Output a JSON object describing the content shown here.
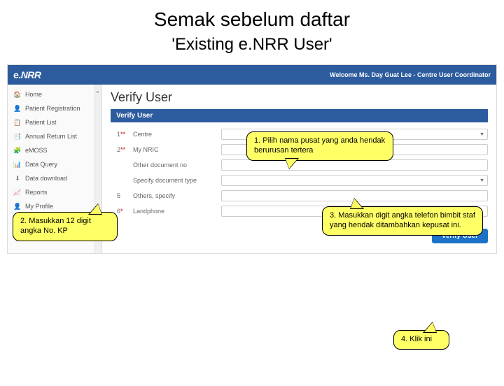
{
  "slide": {
    "title": "Semak sebelum daftar",
    "subtitle": "'Existing e.NRR User'"
  },
  "topbar": {
    "logo_prefix": "e.",
    "logo_main": "NRR",
    "welcome": "Welcome Ms. Day Guat Lee - Centre User Coordinator"
  },
  "sidebar": {
    "items": [
      {
        "icon": "🏠",
        "label": "Home"
      },
      {
        "icon": "👤",
        "label": "Patient Registration"
      },
      {
        "icon": "📋",
        "label": "Patient List"
      },
      {
        "icon": "📑",
        "label": "Annual Return List"
      },
      {
        "icon": "🧩",
        "label": "eMOSS"
      },
      {
        "icon": "📊",
        "label": "Data Query"
      },
      {
        "icon": "⬇",
        "label": "Data download"
      },
      {
        "icon": "📈",
        "label": "Reports"
      },
      {
        "icon": "👤",
        "label": "My Profile"
      }
    ]
  },
  "main": {
    "page_title": "Verify User",
    "panel_title": "Verify User",
    "button": "Verify User",
    "rows": [
      {
        "num": "1",
        "req": "**",
        "label": "Centre",
        "type": "select",
        "value": ""
      },
      {
        "num": "2",
        "req": "**",
        "label": "My NRIC",
        "type": "input",
        "value": ""
      },
      {
        "num": "",
        "req": "",
        "label": "Other document no",
        "type": "input",
        "value": ""
      },
      {
        "num": "",
        "req": "",
        "label": "Specify document type",
        "type": "select",
        "value": ""
      },
      {
        "num": "5",
        "req": "",
        "label": "Others, specify",
        "type": "input",
        "value": ""
      },
      {
        "num": "6",
        "req": "*",
        "label": "Landphone",
        "type": "input",
        "value": ""
      }
    ]
  },
  "callouts": {
    "c1": "1. Pilih nama pusat yang anda hendak berurusan tertera",
    "c2": "2. Masukkan 12 digit angka No. KP",
    "c3": "3. Masukkan digit angka telefon bimbit staf yang hendak ditambahkan kepusat ini.",
    "c4": "4. Klik ini"
  }
}
